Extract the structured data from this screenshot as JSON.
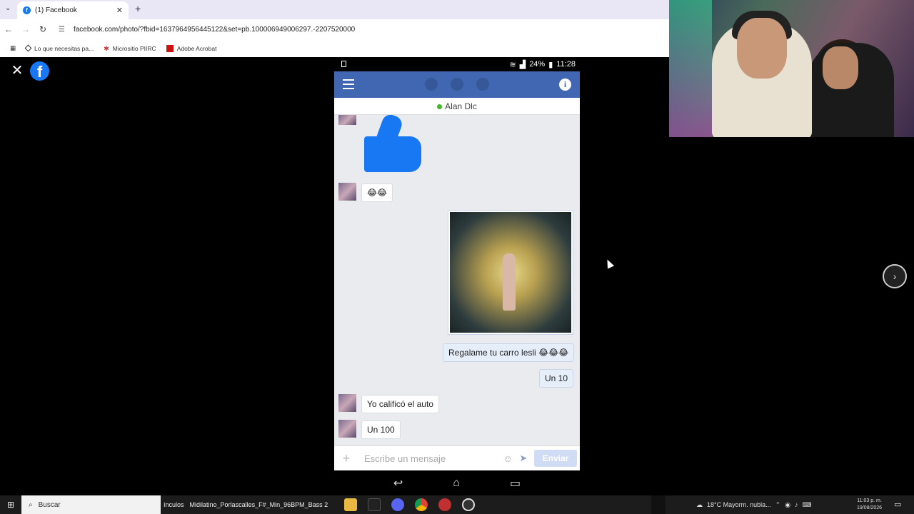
{
  "browser": {
    "tab_title": "(1) Facebook",
    "url": "facebook.com/photo/?fbid=1637964956445122&set=pb.100006949006297.-2207520000",
    "bookmarks": [
      "Lo que necesitas pa...",
      "Micrositio PIIRC",
      "Adobe Acrobat"
    ]
  },
  "viewer": {
    "close_label": "✕",
    "logo": "f",
    "next_label": "›"
  },
  "phone": {
    "status": {
      "battery": "24%",
      "time": "11:28"
    },
    "contact_name": "Alan Dlc",
    "messages": [
      {
        "side": "in",
        "text": "😂😂"
      },
      {
        "side": "out",
        "text": "Regalame tu carro lesli 😂😂😂"
      },
      {
        "side": "out",
        "text": "Un 10"
      },
      {
        "side": "in",
        "text": "Yo calificó el auto"
      },
      {
        "side": "in",
        "text": "Un 100"
      }
    ],
    "composer": {
      "placeholder": "Escribe un mensaje",
      "send_label": "Enviar"
    }
  },
  "taskbar": {
    "search_label": "Buscar",
    "cut_label": "ínculos",
    "open_file": "Midilatino_Porlascalles_F#_Min_96BPM_Bass 2",
    "weather": "18°C  Mayorm. nubla...",
    "time": "11:03 p. m.",
    "date": "19/08/2026",
    "app_icons": [
      "file-explorer-icon",
      "live-icon",
      "discord-icon",
      "chrome-icon",
      "app-red-icon",
      "app-obs-icon"
    ]
  },
  "colors": {
    "fb_blue": "#4267b2",
    "brand": "#1877f2"
  }
}
